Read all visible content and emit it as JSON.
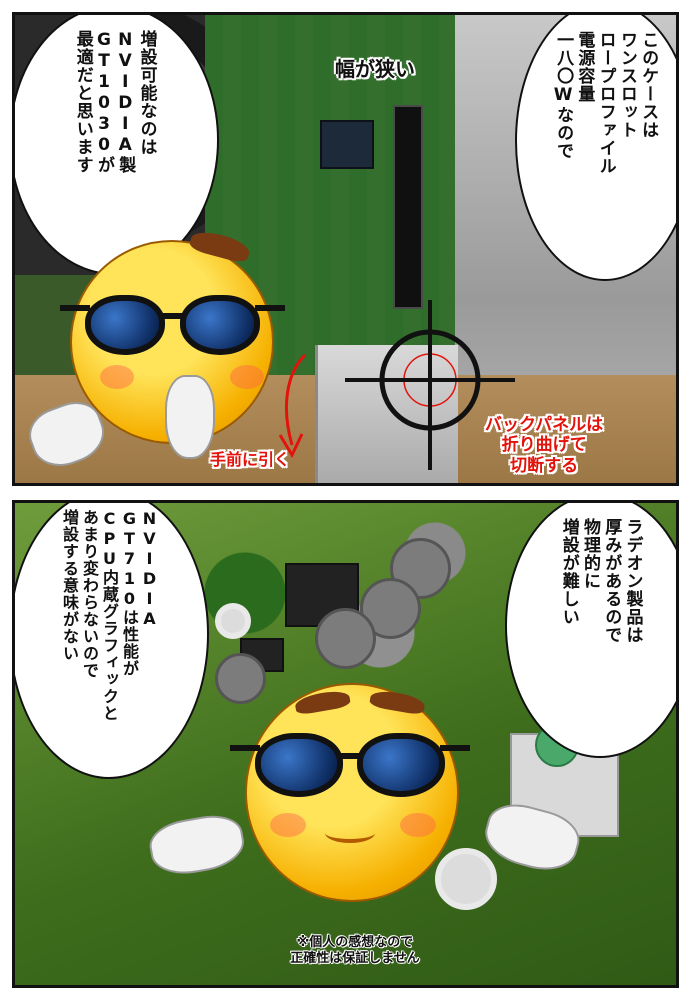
{
  "panel1": {
    "bubble_left_text": "増設可能なのは\nNVIDIA製\nGT1030が\n最適だと思います",
    "bubble_right_text": "このケースは\nワンスロット\nロープロファイル\n電源容量\n一八〇Wなので",
    "narrow_label": "幅が狭い",
    "pull_label": "手前に引く",
    "backpanel_label": "バックパネルは\n折り曲げて\n切断する"
  },
  "panel2": {
    "bubble_left_text": "NVIDIA\nGT710は性能が\nCPU内蔵グラフィックと\nあまり変わらないので\n増設する意味がない",
    "bubble_right_text": "ラデオン製品は\n厚みがあるので\n物理的に\n増設が難しい",
    "disclaimer": "※個人の感想なので\n正確性は保証しません"
  },
  "colors": {
    "accent_red": "#e3130b",
    "face_yellow": "#f6b000",
    "lens_blue": "#1f4fa0"
  }
}
